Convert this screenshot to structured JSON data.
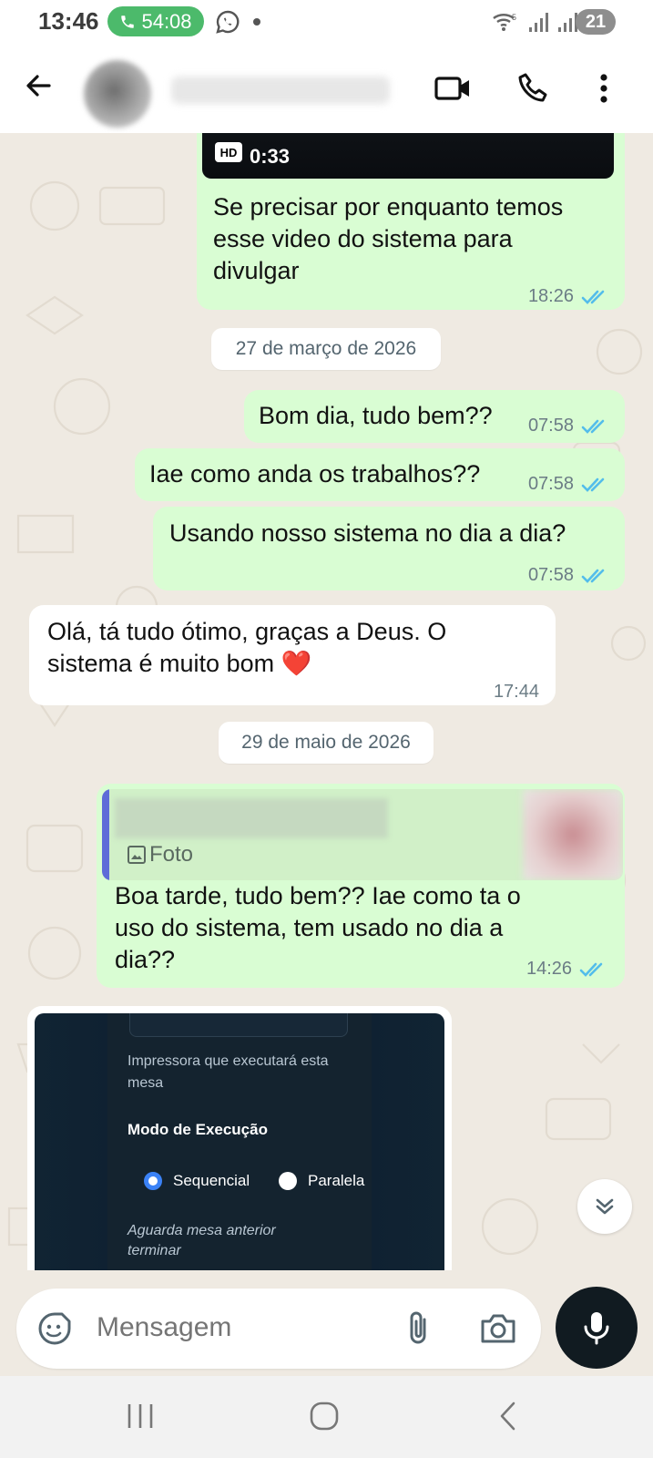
{
  "status_bar": {
    "time": "13:46",
    "call_timer": "54:08",
    "battery": "21"
  },
  "header": {
    "contact_name": "",
    "icons": [
      "back-arrow-icon",
      "video-call-icon",
      "voice-call-icon",
      "more-options-icon"
    ]
  },
  "messages": {
    "video_duration": "0:33",
    "video_hd_label": "HD",
    "video_caption": [
      "Se precisar por enquanto temos",
      "esse video do sistema para",
      "divulgar"
    ],
    "video_time": "18:26",
    "date1": "27 de março de 2026",
    "m1_text": "Bom dia, tudo bem??",
    "m1_time": "07:58",
    "m2_text": "Iae como anda os trabalhos??",
    "m2_time": "07:58",
    "m3_text": "Usando nosso sistema no dia a dia?",
    "m3_time": "07:58",
    "m4_text": [
      "Olá, tá tudo ótimo, graças a Deus. O",
      "sistema é muito bom ❤️"
    ],
    "m4_time": "17:44",
    "date2": "29 de maio de 2026",
    "reply_quote_label": "Foto",
    "m5_text": [
      "Boa tarde, tudo bem?? Iae como ta o",
      "uso do sistema, tem usado no dia a",
      "dia??"
    ],
    "m5_time": "14:26"
  },
  "image_preview": {
    "printer_line1": "Impressora que executará esta",
    "printer_line2": "mesa",
    "mode_title": "Modo de Execução",
    "option_sequential": "Sequencial",
    "option_parallel": "Paralela",
    "wait_line1": "Aguarda mesa anterior",
    "wait_line2": "terminar",
    "selected_option": "Sequencial"
  },
  "composer": {
    "placeholder": "Mensagem"
  },
  "colors": {
    "outgoing_bubble": "#d9fdd3",
    "incoming_bubble": "#ffffff",
    "read_ticks": "#53bdeb",
    "call_pill": "#4cba6b",
    "chat_background": "#efeae2"
  }
}
